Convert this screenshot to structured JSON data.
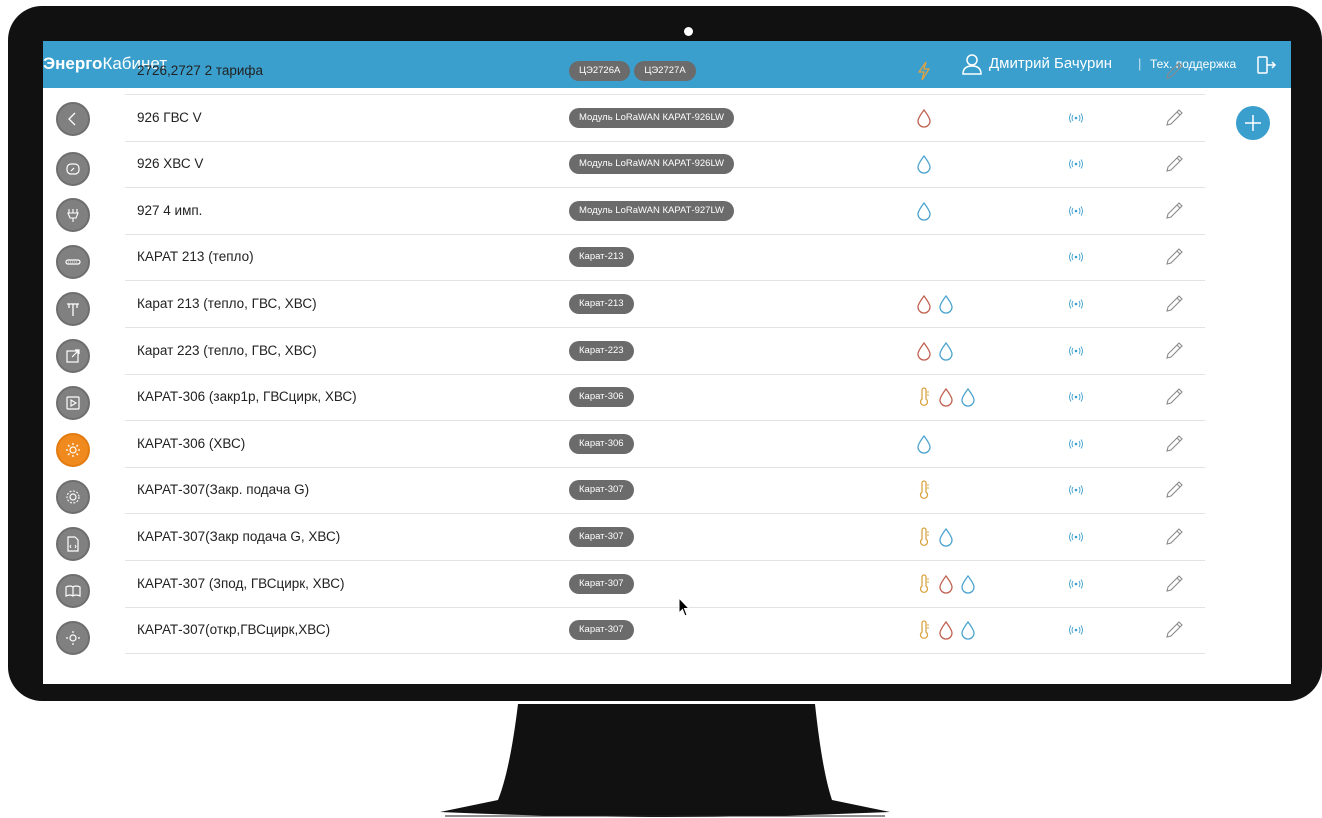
{
  "app": {
    "brand_bold": "Энерго",
    "brand_light": "Кабинет"
  },
  "header": {
    "user_name": "Дмитрий Бачурин",
    "separator": "|",
    "support_label": "Тех. поддержка"
  },
  "colors": {
    "accent": "#3a9fcd",
    "active_nav": "#f08a1e",
    "hot_water": "#c0604f",
    "cold_water": "#4aa3cf",
    "heat": "#d9a441",
    "electric": "#e8a23a",
    "radio": "#3a9fcd"
  },
  "sidebar": {
    "items": [
      {
        "icon": "chevron-left-icon",
        "active": false
      },
      {
        "icon": "gauge-icon",
        "active": false
      },
      {
        "icon": "plug-icon",
        "active": false
      },
      {
        "icon": "meter-icon",
        "active": false
      },
      {
        "icon": "pipe-icon",
        "active": false
      },
      {
        "icon": "external-link-icon",
        "active": false
      },
      {
        "icon": "play-icon",
        "active": false
      },
      {
        "icon": "gear-icon",
        "active": true
      },
      {
        "icon": "settings-icon",
        "active": false
      },
      {
        "icon": "code-file-icon",
        "active": false
      },
      {
        "icon": "book-icon",
        "active": false
      },
      {
        "icon": "sun-icon",
        "active": false
      }
    ]
  },
  "rows": [
    {
      "name": "2726,2727 2 тарифа",
      "tags": [
        "ЦЭ2726А",
        "ЦЭ2727А"
      ],
      "resources": [
        "electric"
      ]
    },
    {
      "name": "926 ГВС V",
      "tags": [
        "Модуль LoRaWAN КАРАТ-926LW"
      ],
      "resources": [
        "hot"
      ]
    },
    {
      "name": "926 ХВС V",
      "tags": [
        "Модуль LoRaWAN КАРАТ-926LW"
      ],
      "resources": [
        "cold"
      ]
    },
    {
      "name": "927 4 имп.",
      "tags": [
        "Модуль LoRaWAN КАРАТ-927LW"
      ],
      "resources": [
        "cold"
      ]
    },
    {
      "name": "КАРАТ 213 (тепло)",
      "tags": [
        "Карат-213"
      ],
      "resources": []
    },
    {
      "name": "Карат 213 (тепло, ГВС, ХВС)",
      "tags": [
        "Карат-213"
      ],
      "resources": [
        "hot",
        "cold"
      ]
    },
    {
      "name": "Карат 223 (тепло, ГВС, ХВС)",
      "tags": [
        "Карат-223"
      ],
      "resources": [
        "hot",
        "cold"
      ]
    },
    {
      "name": "КАРАТ-306 (закр1р, ГВСцирк, ХВС)",
      "tags": [
        "Карат-306"
      ],
      "resources": [
        "heat",
        "hot",
        "cold"
      ]
    },
    {
      "name": "КАРАТ-306 (ХВС)",
      "tags": [
        "Карат-306"
      ],
      "resources": [
        "cold"
      ]
    },
    {
      "name": "КАРАТ-307(Закр. подача G)",
      "tags": [
        "Карат-307"
      ],
      "resources": [
        "heat"
      ]
    },
    {
      "name": "КАРАТ-307(Закр подача G, ХВС)",
      "tags": [
        "Карат-307"
      ],
      "resources": [
        "heat",
        "cold"
      ]
    },
    {
      "name": "КАРАТ-307 (3под, ГВСцирк, ХВС)",
      "tags": [
        "Карат-307"
      ],
      "resources": [
        "heat",
        "hot",
        "cold"
      ]
    },
    {
      "name": "КАРАТ-307(откр,ГВСцирк,ХВС)",
      "tags": [
        "Карат-307"
      ],
      "resources": [
        "heat",
        "hot",
        "cold"
      ]
    }
  ]
}
